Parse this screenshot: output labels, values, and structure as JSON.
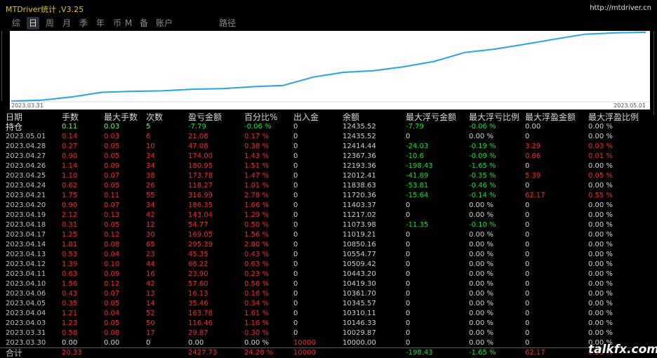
{
  "app": {
    "title": "MTDriver统计 ,V3.25",
    "url": "http://mtdriver.cn"
  },
  "tabs": [
    {
      "label": "综",
      "active": false
    },
    {
      "label": "日",
      "active": true
    },
    {
      "label": "周",
      "active": false
    },
    {
      "label": "月",
      "active": false
    },
    {
      "label": "季",
      "active": false
    },
    {
      "label": "年",
      "active": false
    },
    {
      "label": "币",
      "active": false
    },
    {
      "label": "M",
      "active": false
    },
    {
      "label": "备",
      "active": false
    },
    {
      "label": "账户",
      "active": false
    },
    {
      "label": "路径",
      "active": false
    }
  ],
  "chart_data": {
    "type": "line",
    "x_start_label": "2023.03.31",
    "x_end_label": "2023.05.01",
    "categories": [
      "2023.03.30",
      "2023.03.31",
      "2023.04.03",
      "2023.04.04",
      "2023.04.05",
      "2023.04.06",
      "2023.04.10",
      "2023.04.11",
      "2023.04.12",
      "2023.04.13",
      "2023.04.14",
      "2023.04.17",
      "2023.04.18",
      "2023.04.19",
      "2023.04.20",
      "2023.04.21",
      "2023.04.24",
      "2023.04.25",
      "2023.04.26",
      "2023.04.27",
      "2023.04.28",
      "2023.05.01"
    ],
    "series": [
      {
        "values": [
          10000.0,
          10029.87,
          10146.33,
          10310.11,
          10345.57,
          10361.7,
          10419.3,
          10443.2,
          10509.42,
          10554.77,
          10850.16,
          11019.21,
          11073.98,
          11217.02,
          11403.37,
          11720.36,
          11838.63,
          12012.41,
          12193.36,
          12367.36,
          12414.44,
          12435.52
        ],
        "color": "#1fa8e0"
      }
    ]
  },
  "table": {
    "headers": [
      "日期",
      "手数",
      "最大手数",
      "次数",
      "盈亏金额",
      "百分比%",
      "出入金",
      "余额",
      "最大浮亏金额",
      "最大浮亏比例",
      "最大浮盈金额",
      "最大浮盈比例"
    ],
    "position_row": {
      "date": "持仓",
      "hand": "0.11",
      "max": "0.03",
      "cnt": "5",
      "pl": "-7.79",
      "pct": "-0.06 %",
      "flow": "0",
      "bal": "12435.52",
      "fl": "-7.79",
      "flp": "-0.06 %",
      "fp": "0.00",
      "fpp": "0.00 %"
    },
    "rows": [
      {
        "date": "2023.05.01",
        "hand": "0.14",
        "max": "0.03",
        "cnt": "6",
        "pl": "21.08",
        "pct": "0.17 %",
        "flow": "0",
        "bal": "12435.52",
        "fl": "0",
        "flp": "0.00 %",
        "fp": "0",
        "fpp": "0.00 %"
      },
      {
        "date": "2023.04.28",
        "hand": "0.27",
        "max": "0.05",
        "cnt": "10",
        "pl": "47.08",
        "pct": "0.38 %",
        "flow": "0",
        "bal": "12414.44",
        "fl": "-24.03",
        "flp": "-0.19 %",
        "fp": "3.29",
        "fpp": "0.03 %"
      },
      {
        "date": "2023.04.27",
        "hand": "0.90",
        "max": "0.05",
        "cnt": "34",
        "pl": "174.00",
        "pct": "1.43 %",
        "flow": "0",
        "bal": "12367.36",
        "fl": "-10.6",
        "flp": "-0.09 %",
        "fp": "0.86",
        "fpp": "0.01 %"
      },
      {
        "date": "2023.04.26",
        "hand": "1.14",
        "max": "0.09",
        "cnt": "34",
        "pl": "180.95",
        "pct": "1.51 %",
        "flow": "0",
        "bal": "12193.36",
        "fl": "-198.43",
        "flp": "-1.65 %",
        "fp": "0",
        "fpp": "0.00 %"
      },
      {
        "date": "2023.04.25",
        "hand": "1.10",
        "max": "0.07",
        "cnt": "38",
        "pl": "173.78",
        "pct": "1.47 %",
        "flow": "0",
        "bal": "12012.41",
        "fl": "-41.89",
        "flp": "-0.35 %",
        "fp": "5.39",
        "fpp": "0.05 %"
      },
      {
        "date": "2023.04.24",
        "hand": "0.62",
        "max": "0.05",
        "cnt": "26",
        "pl": "118.27",
        "pct": "1.01 %",
        "flow": "0",
        "bal": "11838.63",
        "fl": "-53.81",
        "flp": "-0.46 %",
        "fp": "0",
        "fpp": "0.00 %"
      },
      {
        "date": "2023.04.21",
        "hand": "1.75",
        "max": "0.11",
        "cnt": "55",
        "pl": "316.99",
        "pct": "2.78 %",
        "flow": "0",
        "bal": "11720.36",
        "fl": "-15.64",
        "flp": "-0.14 %",
        "fp": "62.17",
        "fpp": "0.55 %"
      },
      {
        "date": "2023.04.20",
        "hand": "0.90",
        "max": "0.07",
        "cnt": "34",
        "pl": "186.35",
        "pct": "1.66 %",
        "flow": "0",
        "bal": "11403.37",
        "fl": "0",
        "flp": "0.00 %",
        "fp": "0",
        "fpp": "0.00 %"
      },
      {
        "date": "2023.04.19",
        "hand": "2.12",
        "max": "0.13",
        "cnt": "42",
        "pl": "143.04",
        "pct": "1.29 %",
        "flow": "0",
        "bal": "11217.02",
        "fl": "0",
        "flp": "0.00 %",
        "fp": "0",
        "fpp": "0.00 %"
      },
      {
        "date": "2023.04.18",
        "hand": "0.31",
        "max": "0.05",
        "cnt": "12",
        "pl": "54.77",
        "pct": "0.50 %",
        "flow": "0",
        "bal": "11073.98",
        "fl": "-11.35",
        "flp": "-0.10 %",
        "fp": "0",
        "fpp": "0.00 %"
      },
      {
        "date": "2023.04.17",
        "hand": "1.25",
        "max": "0.12",
        "cnt": "30",
        "pl": "169.05",
        "pct": "1.56 %",
        "flow": "0",
        "bal": "11019.21",
        "fl": "0",
        "flp": "0.00 %",
        "fp": "0",
        "fpp": "0.00 %"
      },
      {
        "date": "2023.04.14",
        "hand": "1.81",
        "max": "0.08",
        "cnt": "65",
        "pl": "295.39",
        "pct": "2.80 %",
        "flow": "0",
        "bal": "10850.16",
        "fl": "0",
        "flp": "0.00 %",
        "fp": "0",
        "fpp": "0.00 %"
      },
      {
        "date": "2023.04.13",
        "hand": "0.53",
        "max": "0.04",
        "cnt": "23",
        "pl": "45.35",
        "pct": "0.43 %",
        "flow": "0",
        "bal": "10554.77",
        "fl": "0",
        "flp": "0.00 %",
        "fp": "0",
        "fpp": "0.00 %"
      },
      {
        "date": "2023.04.12",
        "hand": "1.39",
        "max": "0.10",
        "cnt": "44",
        "pl": "66.22",
        "pct": "0.63 %",
        "flow": "0",
        "bal": "10509.42",
        "fl": "0",
        "flp": "0.00 %",
        "fp": "0",
        "fpp": "0.00 %"
      },
      {
        "date": "2023.04.11",
        "hand": "0.63",
        "max": "0.09",
        "cnt": "16",
        "pl": "23.90",
        "pct": "0.23 %",
        "flow": "0",
        "bal": "10443.20",
        "fl": "0",
        "flp": "0.00 %",
        "fp": "0",
        "fpp": "0.00 %"
      },
      {
        "date": "2023.04.10",
        "hand": "1.56",
        "max": "0.12",
        "cnt": "42",
        "pl": "57.60",
        "pct": "0.56 %",
        "flow": "0",
        "bal": "10419.30",
        "fl": "0",
        "flp": "0.00 %",
        "fp": "0",
        "fpp": "0.00 %"
      },
      {
        "date": "2023.04.06",
        "hand": "0.43",
        "max": "0.07",
        "cnt": "13",
        "pl": "16.13",
        "pct": "0.16 %",
        "flow": "0",
        "bal": "10361.70",
        "fl": "0",
        "flp": "0.00 %",
        "fp": "0",
        "fpp": "0.00 %"
      },
      {
        "date": "2023.04.05",
        "hand": "0.35",
        "max": "0.05",
        "cnt": "14",
        "pl": "35.46",
        "pct": "0.34 %",
        "flow": "0",
        "bal": "10345.57",
        "fl": "0",
        "flp": "0.00 %",
        "fp": "0",
        "fpp": "0.00 %"
      },
      {
        "date": "2023.04.04",
        "hand": "1.21",
        "max": "0.04",
        "cnt": "52",
        "pl": "163.78",
        "pct": "1.61 %",
        "flow": "0",
        "bal": "10310.11",
        "fl": "0",
        "flp": "0.00 %",
        "fp": "0",
        "fpp": "0.00 %"
      },
      {
        "date": "2023.04.03",
        "hand": "1.23",
        "max": "0.05",
        "cnt": "50",
        "pl": "116.46",
        "pct": "1.16 %",
        "flow": "0",
        "bal": "10146.33",
        "fl": "0",
        "flp": "0.00 %",
        "fp": "0",
        "fpp": "0.00 %"
      },
      {
        "date": "2023.03.31",
        "hand": "0.58",
        "max": "0.08",
        "cnt": "17",
        "pl": "29.87",
        "pct": "0.30 %",
        "flow": "0",
        "bal": "10029.87",
        "fl": "0",
        "flp": "0.00 %",
        "fp": "0",
        "fpp": "0.00 %"
      },
      {
        "date": "2023.03.30",
        "hand": "0.00",
        "max": "0.00",
        "cnt": "0",
        "pl": "0.00",
        "pct": "0.00 %",
        "flow": "10000",
        "bal": "10000.00",
        "fl": "0",
        "flp": "0.00 %",
        "fp": "0",
        "fpp": "0.00 %"
      }
    ],
    "total_row": {
      "date": "合计",
      "hand": "20.33",
      "max": "",
      "cnt": "",
      "pl": "2427.73",
      "pct": "24.28 %",
      "flow": "10000",
      "bal": "",
      "fl": "-198.43",
      "flp": "-1.65 %",
      "fp": "62.17",
      "fpp": "0.55 %"
    }
  },
  "watermark": "talkfx.com",
  "colors": {
    "positive": "#e8312c",
    "negative": "#1fdc3a",
    "neutral": "#cfcfcf",
    "title": "#e8c400",
    "line": "#1fa8e0"
  }
}
